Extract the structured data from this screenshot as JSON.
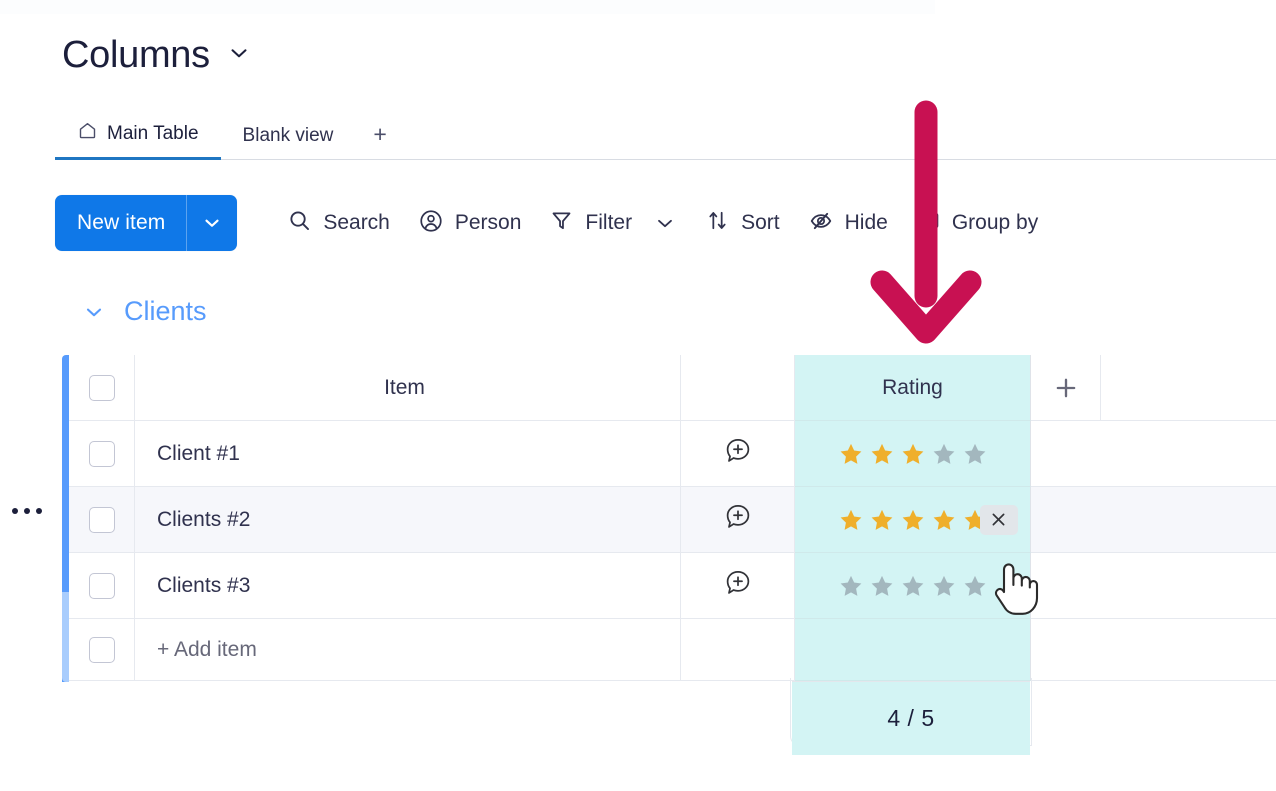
{
  "board": {
    "title": "Columns",
    "title_caret_icon": "chevron-down-icon"
  },
  "tabs": {
    "items": [
      {
        "label": "Main Table",
        "icon": "home-icon",
        "active": true
      },
      {
        "label": "Blank view",
        "icon": "",
        "active": false
      }
    ],
    "add_label": "+"
  },
  "toolbar": {
    "new_item_label": "New item",
    "new_item_caret_icon": "chevron-down-icon",
    "tools": [
      {
        "label": "Search",
        "icon": "search-icon",
        "caret": false
      },
      {
        "label": "Person",
        "icon": "person-icon",
        "caret": false
      },
      {
        "label": "Filter",
        "icon": "filter-icon",
        "caret": true
      },
      {
        "label": "Sort",
        "icon": "sort-icon",
        "caret": false
      },
      {
        "label": "Hide",
        "icon": "eye-hidden-icon",
        "caret": false
      },
      {
        "label": "Group by",
        "icon": "group-by-icon",
        "caret": false
      }
    ]
  },
  "group": {
    "name": "Clients",
    "collapse_icon": "chevron-down-icon",
    "accent_color": "#579bfc"
  },
  "board_menu": {
    "icon": "more-options-icon"
  },
  "table": {
    "columns": [
      {
        "key": "item",
        "label": "Item"
      },
      {
        "key": "chat",
        "label": ""
      },
      {
        "key": "rating",
        "label": "Rating",
        "highlighted": true,
        "highlight_color": "#d3f4f4"
      }
    ],
    "add_column_label": "+",
    "rows": [
      {
        "name": "Client #1",
        "chat_icon": "add-comment-icon",
        "rating": 3,
        "rating_max": 5,
        "hovered": false,
        "show_clear": false
      },
      {
        "name": "Clients #2",
        "chat_icon": "add-comment-icon",
        "rating": 5,
        "rating_max": 5,
        "hovered": true,
        "show_clear": true,
        "clear_icon": "close-icon"
      },
      {
        "name": "Clients #3",
        "chat_icon": "add-comment-icon",
        "rating": 0,
        "rating_max": 5,
        "hovered": false,
        "show_clear": false
      }
    ],
    "add_item_label": "+ Add item",
    "summary": {
      "value": "4 / 5"
    }
  },
  "annotation": {
    "arrow_color": "#C81152",
    "arrow_icon": "down-arrow-annotation"
  },
  "cursor": {
    "icon": "pointing-hand-cursor"
  },
  "colors": {
    "primary_blue": "#0f78e8",
    "group_blue": "#579bfc",
    "star_filled": "#efaf2b",
    "star_empty": "#a3b7be",
    "rating_tint": "#d3f4f4",
    "annotation": "#C81152"
  }
}
